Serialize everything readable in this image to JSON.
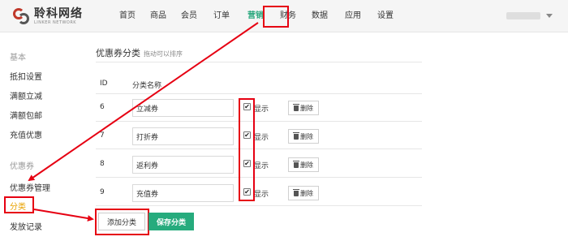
{
  "brand": {
    "name_cn": "聆科网络",
    "name_en": "LINKER NETWORK"
  },
  "nav": [
    {
      "label": "首页"
    },
    {
      "label": "商品"
    },
    {
      "label": "会员"
    },
    {
      "label": "订单"
    },
    {
      "label": "营销",
      "active": true
    },
    {
      "label": "财务"
    },
    {
      "label": "数据"
    },
    {
      "label": "应用"
    },
    {
      "label": "设置"
    }
  ],
  "sidebar": {
    "group1": "基本",
    "items1": [
      "抵扣设置",
      "满额立减",
      "满额包邮",
      "充值优惠"
    ],
    "group2": "优惠券",
    "items2": [
      "优惠券管理",
      "分类",
      "发放记录"
    ]
  },
  "main": {
    "title": "优惠券分类",
    "subtitle": "拖动可以排序",
    "columns": {
      "id": "ID",
      "name": "分类名称"
    },
    "rows": [
      {
        "id": "6",
        "name": "立减券",
        "show_label": "显示",
        "checked": true,
        "delete_label": "删除"
      },
      {
        "id": "7",
        "name": "打折券",
        "show_label": "显示",
        "checked": true,
        "delete_label": "删除"
      },
      {
        "id": "8",
        "name": "返利券",
        "show_label": "显示",
        "checked": true,
        "delete_label": "删除"
      },
      {
        "id": "9",
        "name": "充值券",
        "show_label": "显示",
        "checked": true,
        "delete_label": "删除"
      }
    ],
    "add_label": "添加分类",
    "save_label": "保存分类"
  },
  "colors": {
    "accent": "#2aa87e",
    "save": "#26ab7d",
    "highlight": "#e60012",
    "sidebar_active": "#e8a200"
  },
  "icons": [
    "logo-icon",
    "chevron-down-icon",
    "checkbox-icon",
    "trash-icon",
    "arrow-icon"
  ]
}
